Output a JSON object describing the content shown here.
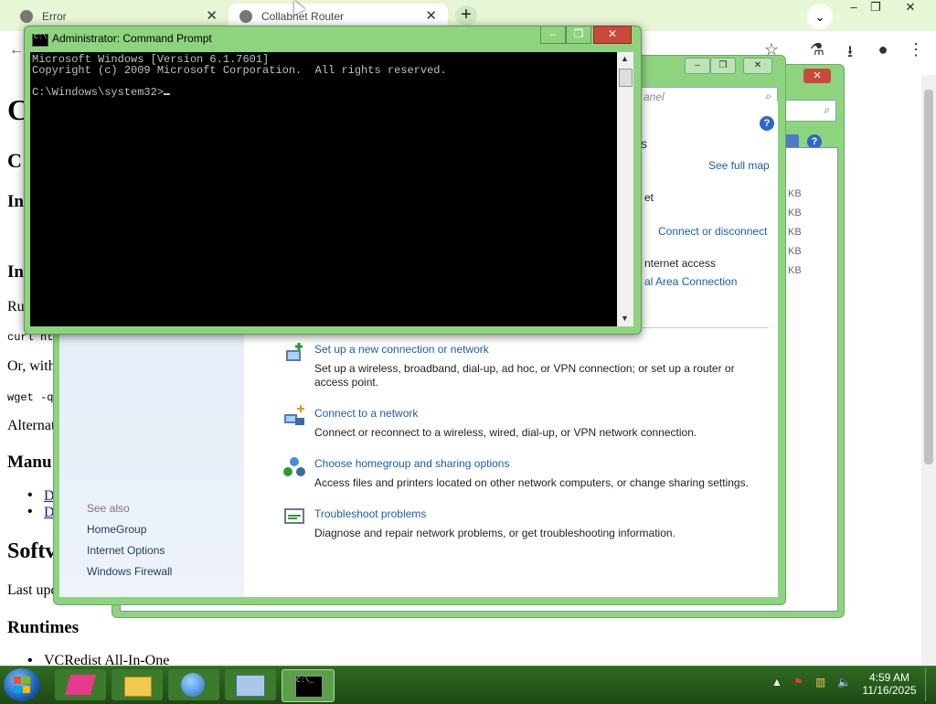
{
  "browser": {
    "tabs": [
      {
        "title": "Error"
      },
      {
        "title": "Collabnet Router"
      }
    ],
    "page": {
      "lines": [
        "C",
        "C",
        "In",
        "In",
        "Ru",
        "curl ht",
        "Or, with",
        "wget -q",
        "Alternat",
        "Manu"
      ],
      "links": [
        "D",
        "D"
      ],
      "software_heading": "Softv",
      "last_updated": "Last upd",
      "runtimes_heading": "Runtimes",
      "runtimes_item": "VCRedist All-In-One"
    }
  },
  "explorer_back": {
    "sizes": [
      "KB",
      "KB",
      "KB",
      "KB",
      "KB"
    ]
  },
  "network_center": {
    "search_placeholder": "anel",
    "partial_heading": "s",
    "see_full_map": "See full map",
    "partial_text_1": "et",
    "connect_or_disconnect": "Connect or disconnect",
    "internet_access": "nternet access",
    "area_connection": "al Area Connection",
    "tasks": [
      {
        "title": "Set up a new connection or network",
        "desc": "Set up a wireless, broadband, dial-up, ad hoc, or VPN connection; or set up a router or access point."
      },
      {
        "title": "Connect to a network",
        "desc": "Connect or reconnect to a wireless, wired, dial-up, or VPN network connection."
      },
      {
        "title": "Choose homegroup and sharing options",
        "desc": "Access files and printers located on other network computers, or change sharing settings."
      },
      {
        "title": "Troubleshoot problems",
        "desc": "Diagnose and repair network problems, or get troubleshooting information."
      }
    ],
    "see_also": {
      "heading": "See also",
      "links": [
        "HomeGroup",
        "Internet Options",
        "Windows Firewall"
      ]
    }
  },
  "cmd": {
    "title": "Administrator: Command Prompt",
    "lines": [
      "Microsoft Windows [Version 6.1.7601]",
      "Copyright (c) 2009 Microsoft Corporation.  All rights reserved.",
      "",
      "C:\\Windows\\system32>"
    ]
  },
  "taskbar": {
    "time": "4:59 AM",
    "date": "11/16/2025",
    "apps": [
      "app-1",
      "windows-explorer",
      "network",
      "control-panel",
      "command-prompt"
    ]
  },
  "icons": [
    "globe-icon",
    "close-icon",
    "plus-icon",
    "chevron-down-icon",
    "minimize-icon",
    "maximize-icon",
    "star-icon",
    "flask-icon",
    "download-icon",
    "profile-icon",
    "kebab-menu-icon",
    "search-icon",
    "help-icon",
    "cmd-icon",
    "windows-start-icon"
  ]
}
